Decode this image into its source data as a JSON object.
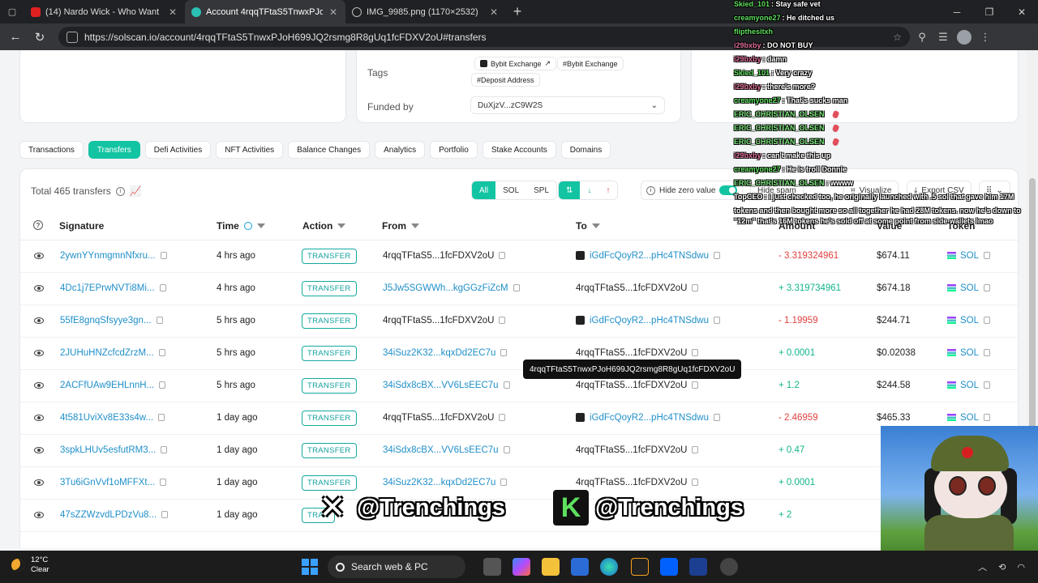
{
  "browser": {
    "tabs": [
      {
        "title": "(14) Nardo Wick - Who Want Sm",
        "favicon": "youtube-icon",
        "active": false
      },
      {
        "title": "Account 4rqqTFtaS5TnwxPJoH699",
        "favicon": "solscan-icon",
        "active": true
      },
      {
        "title": "IMG_9985.png (1170×2532)",
        "favicon": "globe-icon",
        "active": false
      }
    ],
    "url": "https://solscan.io/account/4rqqTFtaS5TnwxPJoH699JQ2rsmg8R8gUq1fcFDXV2oU#transfers"
  },
  "account_info": {
    "tags_label": "Tags",
    "tags": [
      "Bybit Exchange",
      "#Bybit Exchange",
      "#Deposit Address"
    ],
    "funded_by_label": "Funded by",
    "funded_by_value": "DuXjzV...zC9W2S"
  },
  "subtabs": [
    "Transactions",
    "Transfers",
    "Defi Activities",
    "NFT Activities",
    "Balance Changes",
    "Analytics",
    "Portfolio",
    "Stake Accounts",
    "Domains"
  ],
  "active_subtab": "Transfers",
  "toolbar": {
    "total": "Total 465 transfers",
    "filters": [
      "All",
      "SOL",
      "SPL"
    ],
    "hide_zero": "Hide zero value",
    "hide_spam": "Hide spam",
    "visualize": "Visualize",
    "export": "Export CSV"
  },
  "table": {
    "columns": [
      "Signature",
      "Time",
      "Action",
      "From",
      "To",
      "Amount",
      "Value",
      "Token"
    ],
    "rows": [
      {
        "sig": "2ywnYYnmgmnNfxru...",
        "time": "4 hrs ago",
        "action": "TRANSFER",
        "from": "4rqqTFtaS5...1fcFDXV2oU",
        "from_link": false,
        "to": "iGdFcQoyR2...pHc4TNSdwu",
        "to_link": true,
        "amount": "- 3.319324961",
        "dir": "neg",
        "value": "$674.11",
        "token": "SOL"
      },
      {
        "sig": "4Dc1j7EPrwNVTi8Mi...",
        "time": "4 hrs ago",
        "action": "TRANSFER",
        "from": "J5Jw5SGWWh...kgGGzFiZcM",
        "from_link": true,
        "to": "4rqqTFtaS5...1fcFDXV2oU",
        "to_link": false,
        "amount": "+ 3.319734961",
        "dir": "pos",
        "value": "$674.18",
        "token": "SOL"
      },
      {
        "sig": "55fE8gnqSfsyye3gn...",
        "time": "5 hrs ago",
        "action": "TRANSFER",
        "from": "4rqqTFtaS5...1fcFDXV2oU",
        "from_link": false,
        "to": "iGdFcQoyR2...pHc4TNSdwu",
        "to_link": true,
        "amount": "- 1.19959",
        "dir": "neg",
        "value": "$244.71",
        "token": "SOL"
      },
      {
        "sig": "2JUHuHNZcfcdZrzM...",
        "time": "5 hrs ago",
        "action": "TRANSFER",
        "from": "34iSuz2K32...kqxDd2EC7u",
        "from_link": true,
        "to": "4rqqTFtaS5...1fcFDXV2oU",
        "to_link": false,
        "amount": "+ 0.0001",
        "dir": "pos",
        "value": "$0.02038",
        "token": "SOL"
      },
      {
        "sig": "2ACFfUAw9EHLnnH...",
        "time": "5 hrs ago",
        "action": "TRANSFER",
        "from": "34iSdx8cBX...VV6LsEEC7u",
        "from_link": true,
        "to": "4rqqTFtaS5...1fcFDXV2oU",
        "to_link": false,
        "amount": "+ 1.2",
        "dir": "pos",
        "value": "$244.58",
        "token": "SOL"
      },
      {
        "sig": "4t581UviXv8E33s4w...",
        "time": "1 day ago",
        "action": "TRANSFER",
        "from": "4rqqTFtaS5...1fcFDXV2oU",
        "from_link": false,
        "to": "iGdFcQoyR2...pHc4TNSdwu",
        "to_link": true,
        "amount": "- 2.46959",
        "dir": "neg",
        "value": "$465.33",
        "token": "SOL"
      },
      {
        "sig": "3spkLHUv5esfutRM3...",
        "time": "1 day ago",
        "action": "TRANSFER",
        "from": "34iSdx8cBX...VV6LsEEC7u",
        "from_link": true,
        "to": "4rqqTFtaS5...1fcFDXV2oU",
        "to_link": false,
        "amount": "+ 0.47",
        "dir": "pos",
        "value": "",
        "token": ""
      },
      {
        "sig": "3Tu6iGnVvf1oMFFXt...",
        "time": "1 day ago",
        "action": "TRANSFER",
        "from": "34iSuz2K32...kqxDd2EC7u",
        "from_link": true,
        "to": "4rqqTFtaS5...1fcFDXV2oU",
        "to_link": false,
        "amount": "+ 0.0001",
        "dir": "pos",
        "value": "",
        "token": ""
      },
      {
        "sig": "47sZZWzvdLPDzVu8...",
        "time": "1 day ago",
        "action": "TRAN",
        "from": "",
        "from_link": true,
        "to": "",
        "to_link": false,
        "amount": "+ 2",
        "dir": "pos",
        "value": "",
        "token": ""
      }
    ]
  },
  "tooltip": "4rqqTFtaS5TnwxPJoH699JQ2rsmg8R8gUq1fcFDXV2oU",
  "chat": [
    {
      "user": "Skied_101",
      "msg": "Stay safe vet",
      "color": "green"
    },
    {
      "user": "creamyone27",
      "msg": "He ditched us",
      "color": "green"
    },
    {
      "user": "flipthesitxh",
      "msg": "",
      "color": "green"
    },
    {
      "user": "i29bxby",
      "msg": "DO NOT BUY",
      "color": "pink"
    },
    {
      "user": "i29bxby",
      "msg": "damn",
      "color": "pink"
    },
    {
      "user": "Skied_101",
      "msg": "Very crazy",
      "color": "green"
    },
    {
      "user": "i29bxby",
      "msg": "there's more?",
      "color": "pink"
    },
    {
      "user": "creamyone27",
      "msg": "That's sucks man",
      "color": "green"
    },
    {
      "user": "ERIC_CHRISTIAN_OLSEN",
      "msg": "",
      "color": "lime"
    },
    {
      "user": "ERIC_CHRISTIAN_OLSEN",
      "msg": "",
      "color": "lime"
    },
    {
      "user": "ERIC_CHRISTIAN_OLSEN",
      "msg": "",
      "color": "lime"
    },
    {
      "user": "i29bxby",
      "msg": "can't make this up",
      "color": "pink"
    },
    {
      "user": "creamyone27",
      "msg": "He is troll Donnie",
      "color": "green"
    },
    {
      "user": "ERIC_CHRISTIAN_OLSEN",
      "msg": "wwww",
      "color": "lime"
    },
    {
      "user": "TopCEO",
      "msg": "i just checked too, he originally launched with .5 sol that gave him 17M",
      "color": "white"
    },
    {
      "user": "",
      "msg": "tokens and then bought more so all together he had 28M tokens. now he's down to",
      "color": "white"
    },
    {
      "user": "",
      "msg": "\"12m\" that's 16M tokens he's sold off at some point from side wallets lmao",
      "color": "white"
    }
  ],
  "watermark": {
    "x_handle": "@Trenchings",
    "kick_handle": "@Trenchings"
  },
  "taskbar": {
    "temp": "12°C",
    "weather": "Clear",
    "search": "Search web & PC"
  }
}
